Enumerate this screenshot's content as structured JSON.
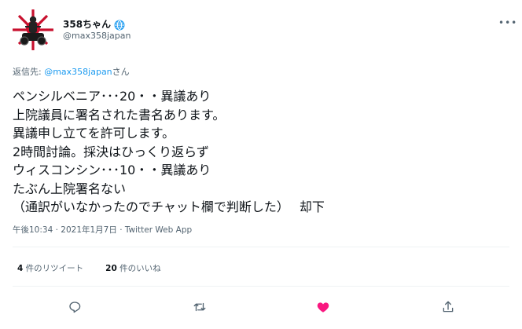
{
  "author": {
    "display_name": "358ちゃん",
    "handle": "@max358japan",
    "badge_icon": "blue-globe-badge",
    "avatar_icon": "rising-sun-biker-avatar"
  },
  "more_label": "•••",
  "reply_to": {
    "prefix": "返信先: ",
    "mention": "@max358japan",
    "suffix": "さん"
  },
  "tweet": {
    "lines": [
      "ペンシルベニア･･･20・・異議あり",
      "上院議員に署名された書名あります。",
      "異議申し立てを許可します。",
      "2時間討論。採決はひっくり返らず",
      "ウィスコンシン･･･10・・異議あり",
      "たぶん上院署名ない",
      "（通訳がいなかったのでチャット欄で判断した）　 却下"
    ]
  },
  "meta": {
    "time": "午後10:34 · 2021年1月7日 · ",
    "source": "Twitter Web App"
  },
  "stats": {
    "retweets_count": "4",
    "retweets_label": " 件のリツイート",
    "likes_count": "20",
    "likes_label": " 件のいいね"
  },
  "actions": [
    {
      "icon": "reply-icon"
    },
    {
      "icon": "retweet-icon"
    },
    {
      "icon": "heart-icon"
    },
    {
      "icon": "share-icon"
    }
  ],
  "colors": {
    "accent": "#1d9bf0",
    "like": "#f91880",
    "muted": "#536471",
    "text": "#0f1419"
  }
}
